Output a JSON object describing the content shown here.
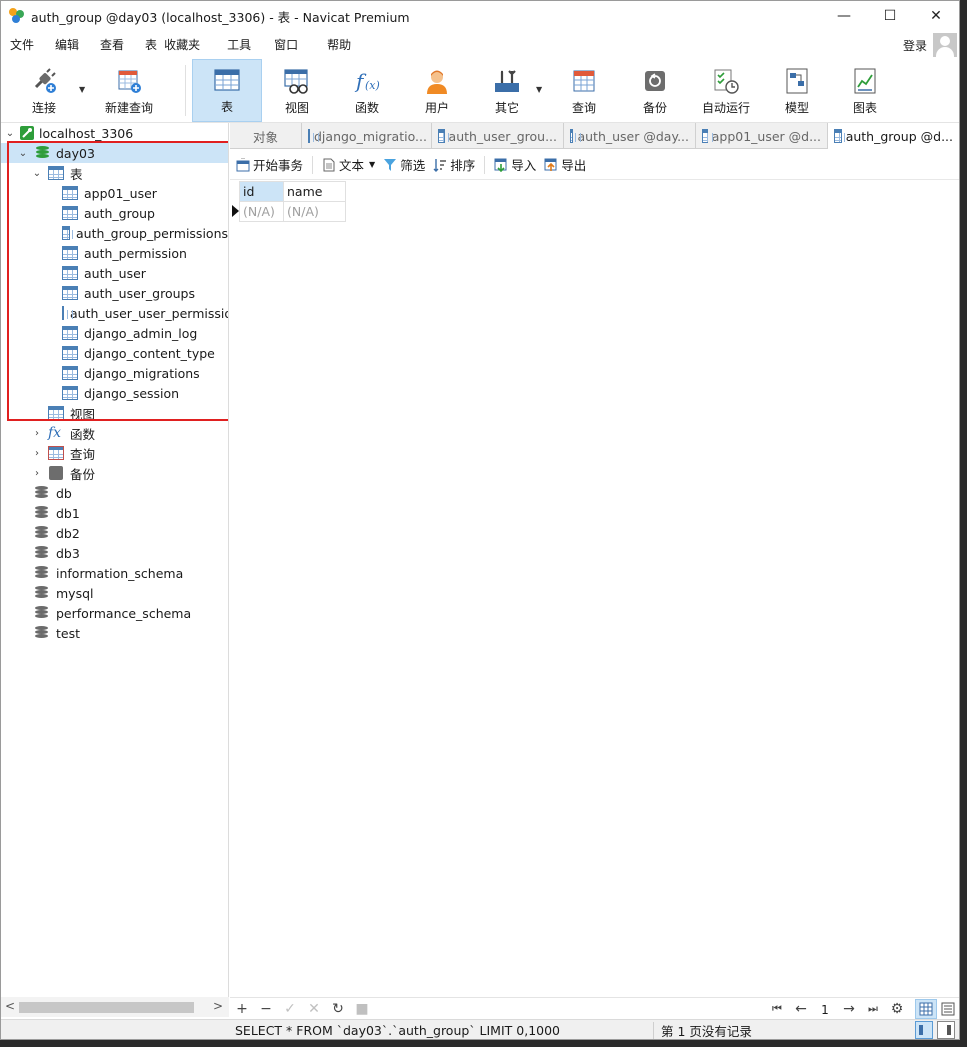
{
  "window": {
    "title": "auth_group @day03 (localhost_3306) - 表 - Navicat Premium",
    "controls": {
      "minimize": "—",
      "maximize": "☐",
      "close": "✕"
    }
  },
  "menu": {
    "items": [
      "文件",
      "编辑",
      "查看",
      "表",
      "收藏夹",
      "工具",
      "窗口",
      "帮助"
    ],
    "login": "登录"
  },
  "toolbar": {
    "buttons": [
      {
        "label": "连接",
        "icon": "plug-icon"
      },
      {
        "label": "新建查询",
        "icon": "new-query-icon"
      },
      {
        "label": "表",
        "icon": "table-icon",
        "active": true
      },
      {
        "label": "视图",
        "icon": "view-icon"
      },
      {
        "label": "函数",
        "icon": "function-icon"
      },
      {
        "label": "用户",
        "icon": "user-icon"
      },
      {
        "label": "其它",
        "icon": "tools-icon"
      },
      {
        "label": "查询",
        "icon": "query-icon"
      },
      {
        "label": "备份",
        "icon": "backup-icon"
      },
      {
        "label": "自动运行",
        "icon": "autorun-icon"
      },
      {
        "label": "模型",
        "icon": "model-icon"
      },
      {
        "label": "图表",
        "icon": "chart-icon"
      }
    ]
  },
  "sidebar": {
    "connection": "localhost_3306",
    "database": "day03",
    "tables_group": "表",
    "tables": [
      "app01_user",
      "auth_group",
      "auth_group_permissions",
      "auth_permission",
      "auth_user",
      "auth_user_groups",
      "auth_user_user_permissio",
      "django_admin_log",
      "django_content_type",
      "django_migrations",
      "django_session"
    ],
    "groups": [
      "视图",
      "函数",
      "查询",
      "备份"
    ],
    "other_databases": [
      "db",
      "db1",
      "db2",
      "db3",
      "information_schema",
      "mysql",
      "performance_schema",
      "test"
    ],
    "scroll_left": "<",
    "scroll_right": ">"
  },
  "tabs": {
    "objects": "对象",
    "items": [
      "django_migratio...",
      "auth_user_grou...",
      "auth_user @day...",
      "app01_user @d...",
      "auth_group @d..."
    ]
  },
  "subtoolbar": {
    "begin_transaction": "开始事务",
    "text": "文本",
    "filter": "筛选",
    "sort": "排序",
    "import": "导入",
    "export": "导出"
  },
  "grid": {
    "columns": [
      "id",
      "name"
    ],
    "rows": [
      [
        "(N/A)",
        "(N/A)"
      ]
    ]
  },
  "nav": {
    "add": "+",
    "remove": "−",
    "apply": "✓",
    "cancel": "✕",
    "refresh": "↻",
    "stop": "■",
    "first": "⏮",
    "prev": "←",
    "page": "1",
    "next": "→",
    "last": "⏭",
    "settings": "⚙"
  },
  "status": {
    "query": "SELECT * FROM `day03`.`auth_group` LIMIT 0,1000",
    "pager": "第 1 页没有记录"
  },
  "colors": {
    "accent": "#cce4f7",
    "highlight_box": "#e02020",
    "db_green": "#2e9d3a",
    "table_blue": "#4a7fb5"
  }
}
